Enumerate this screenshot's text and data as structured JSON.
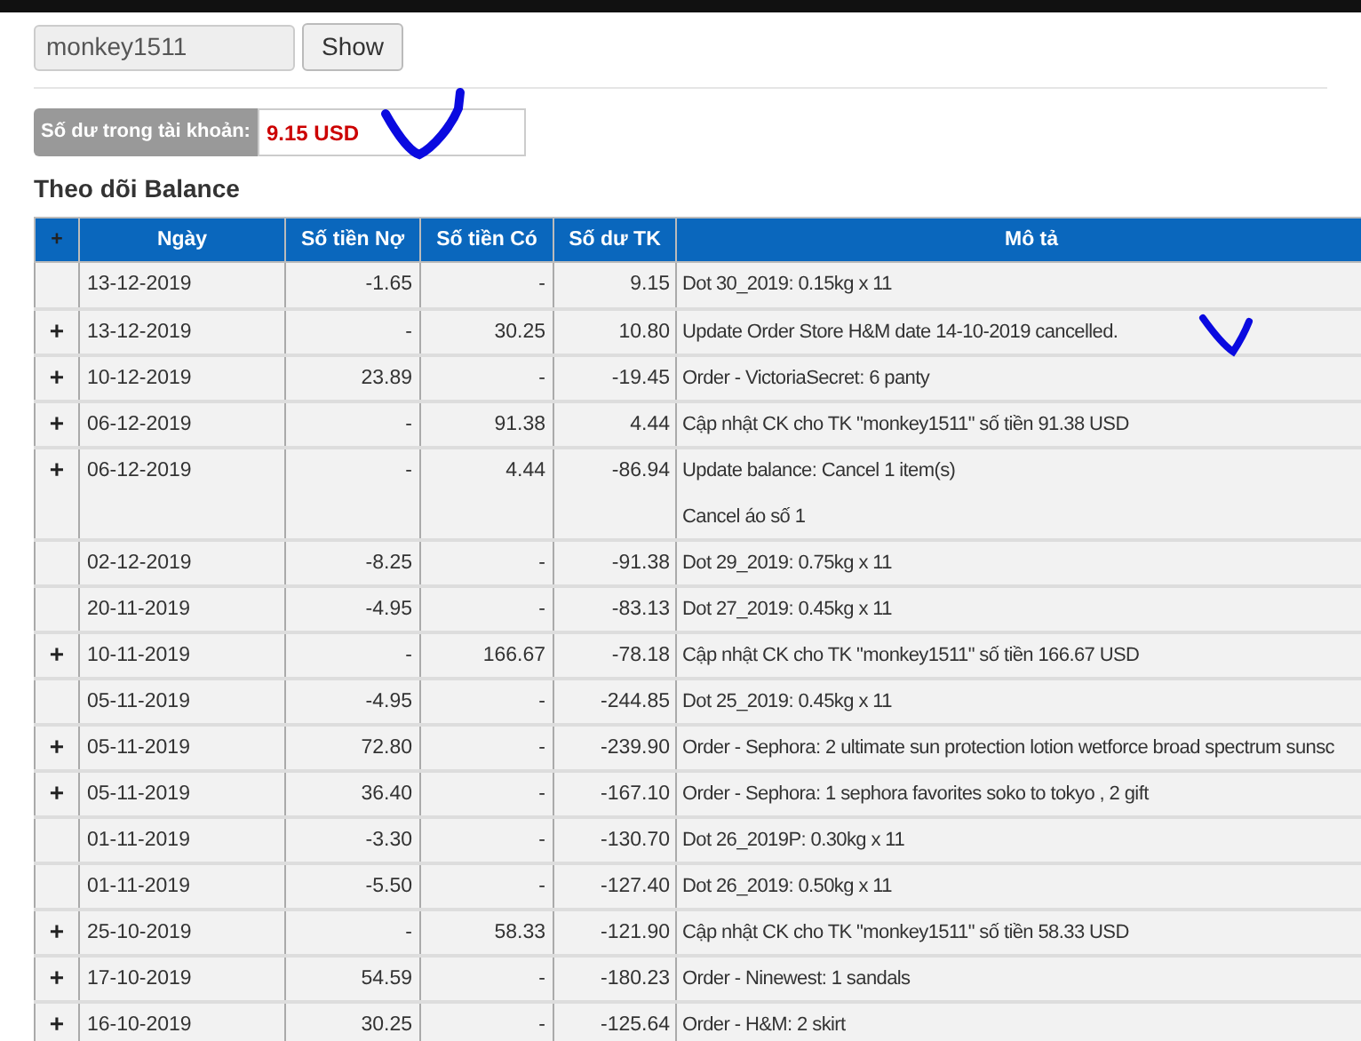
{
  "lookup": {
    "username": "monkey1511",
    "button": "Show"
  },
  "balance": {
    "label": "Số dư trong tài khoản:",
    "value": "9.15 USD"
  },
  "section_title": "Theo dõi Balance",
  "table": {
    "columns": [
      "+",
      "Ngày",
      "Số tiền Nợ",
      "Số tiền Có",
      "Số dư TK",
      "Mô tả"
    ],
    "rows": [
      {
        "expand": "",
        "date": "13-12-2019",
        "debit": "-1.65",
        "credit": "-",
        "balance": "9.15",
        "description": [
          "Dot 30_2019: 0.15kg x 11"
        ]
      },
      {
        "expand": "+",
        "date": "13-12-2019",
        "debit": "-",
        "credit": "30.25",
        "balance": "10.80",
        "description": [
          "Update Order Store H&M date 14-10-2019 cancelled."
        ]
      },
      {
        "expand": "+",
        "date": "10-12-2019",
        "debit": "23.89",
        "credit": "-",
        "balance": "-19.45",
        "description": [
          "Order - VictoriaSecret: 6 panty"
        ]
      },
      {
        "expand": "+",
        "date": "06-12-2019",
        "debit": "-",
        "credit": "91.38",
        "balance": "4.44",
        "description": [
          "Cập nhật CK cho TK \"monkey1511\" số tiền 91.38 USD"
        ]
      },
      {
        "expand": "+",
        "date": "06-12-2019",
        "debit": "-",
        "credit": "4.44",
        "balance": "-86.94",
        "description": [
          "Update balance: Cancel 1 item(s)",
          "Cancel áo số 1"
        ]
      },
      {
        "expand": "",
        "date": "02-12-2019",
        "debit": "-8.25",
        "credit": "-",
        "balance": "-91.38",
        "description": [
          "Dot 29_2019: 0.75kg x 11"
        ]
      },
      {
        "expand": "",
        "date": "20-11-2019",
        "debit": "-4.95",
        "credit": "-",
        "balance": "-83.13",
        "description": [
          "Dot 27_2019: 0.45kg x 11"
        ]
      },
      {
        "expand": "+",
        "date": "10-11-2019",
        "debit": "-",
        "credit": "166.67",
        "balance": "-78.18",
        "description": [
          "Cập nhật CK cho TK \"monkey1511\" số tiền 166.67 USD"
        ]
      },
      {
        "expand": "",
        "date": "05-11-2019",
        "debit": "-4.95",
        "credit": "-",
        "balance": "-244.85",
        "description": [
          "Dot 25_2019: 0.45kg x 11"
        ]
      },
      {
        "expand": "+",
        "date": "05-11-2019",
        "debit": "72.80",
        "credit": "-",
        "balance": "-239.90",
        "description": [
          "Order - Sephora: 2 ultimate sun protection lotion wetforce broad spectrum sunsc"
        ]
      },
      {
        "expand": "+",
        "date": "05-11-2019",
        "debit": "36.40",
        "credit": "-",
        "balance": "-167.10",
        "description": [
          "Order - Sephora: 1 sephora favorites soko to tokyo , 2 gift"
        ]
      },
      {
        "expand": "",
        "date": "01-11-2019",
        "debit": "-3.30",
        "credit": "-",
        "balance": "-130.70",
        "description": [
          "Dot 26_2019P: 0.30kg x 11"
        ]
      },
      {
        "expand": "",
        "date": "01-11-2019",
        "debit": "-5.50",
        "credit": "-",
        "balance": "-127.40",
        "description": [
          "Dot 26_2019: 0.50kg x 11"
        ]
      },
      {
        "expand": "+",
        "date": "25-10-2019",
        "debit": "-",
        "credit": "58.33",
        "balance": "-121.90",
        "description": [
          "Cập nhật CK cho TK \"monkey1511\" số tiền 58.33 USD"
        ]
      },
      {
        "expand": "+",
        "date": "17-10-2019",
        "debit": "54.59",
        "credit": "-",
        "balance": "-180.23",
        "description": [
          "Order - Ninewest: 1 sandals"
        ]
      },
      {
        "expand": "+",
        "date": "16-10-2019",
        "debit": "30.25",
        "credit": "-",
        "balance": "-125.64",
        "description": [
          "Order - H&M: 2 skirt"
        ]
      }
    ]
  }
}
